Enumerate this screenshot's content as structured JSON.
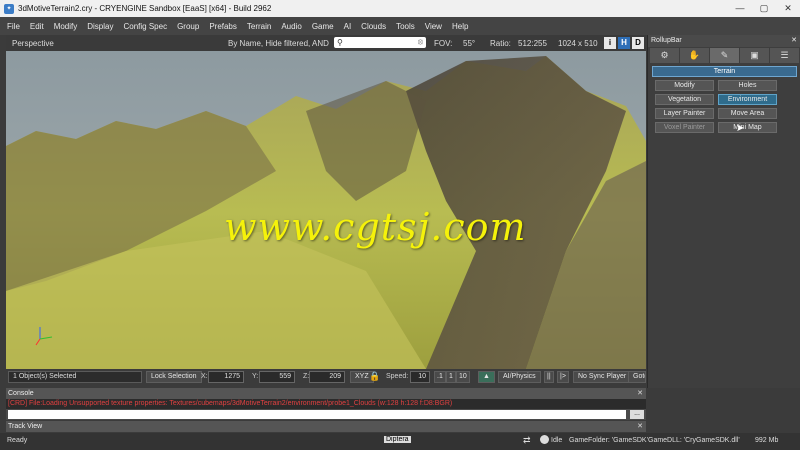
{
  "window": {
    "title": "3dMotiveTerrain2.cry - CRYENGINE Sandbox [EaaS] [x64] - Build 2962",
    "controls": [
      "—",
      "▢",
      "✕"
    ]
  },
  "menu": [
    "File",
    "Edit",
    "Modify",
    "Display",
    "Config Spec",
    "Group",
    "Prefabs",
    "Terrain",
    "Audio",
    "Game",
    "AI",
    "Clouds",
    "Tools",
    "View",
    "Help"
  ],
  "viewport": {
    "title": "Perspective",
    "filter_label": "By Name, Hide filtered, AND",
    "search_value": "",
    "fov_label": "FOV:",
    "fov_value": "55°",
    "ratio_label": "Ratio:",
    "ratio_value": "512:255",
    "resolution": "1024 x 510",
    "btn_i": "i",
    "btn_h": "H",
    "btn_d": "D",
    "watermark": "www.cgtsj.com"
  },
  "toolbar": {
    "selected": "1 Object(s) Selected",
    "lock_selection": "Lock Selection",
    "x_label": "X:",
    "x_value": "1275",
    "y_label": "Y:",
    "y_value": "559",
    "z_label": "Z:",
    "z_value": "209",
    "xyz_label": "XYZ",
    "speed_label": "Speed:",
    "speed_value": "10",
    "speed_1": ".1",
    "speed_2": "1",
    "speed_3": "10",
    "ai_physics": "AI/Physics",
    "pause": "||",
    "step": "|>",
    "sync_player": "No Sync Player",
    "goto": "Goto p"
  },
  "console": {
    "title": "Console",
    "log": "[CRD] File:Loading Unsupported texture properties: Textures/cubemaps/3dMotiveTerrain2/environment/probe1_Clouds (w:128 h:128 f:D8:BGR)",
    "dots": "..."
  },
  "trackview": {
    "title": "Track View"
  },
  "status": {
    "ready": "Ready",
    "center": "Diptera",
    "idle": "Idle",
    "game_folder": "GameFolder: 'GameSDK'",
    "game_dll": "GameDLL: 'CryGameSDK.dll'",
    "memory": "992 Mb"
  },
  "rollup": {
    "title": "RollupBar",
    "tab_icons": [
      "gear-icon",
      "hand-icon",
      "brush-icon",
      "display-icon",
      "layers-icon"
    ],
    "section": "Terrain",
    "buttons": [
      {
        "label": "Modify"
      },
      {
        "label": "Holes"
      },
      {
        "label": "Vegetation"
      },
      {
        "label": "Environment"
      },
      {
        "label": "Layer Painter"
      },
      {
        "label": "Move Area"
      },
      {
        "label": "Voxel Painter"
      },
      {
        "label": "Mini Map"
      }
    ],
    "selected_button": "Environment"
  },
  "colors": {
    "accent": "#2f6c8c",
    "console_error": "#e04040",
    "watermark": "#f5f20a"
  }
}
